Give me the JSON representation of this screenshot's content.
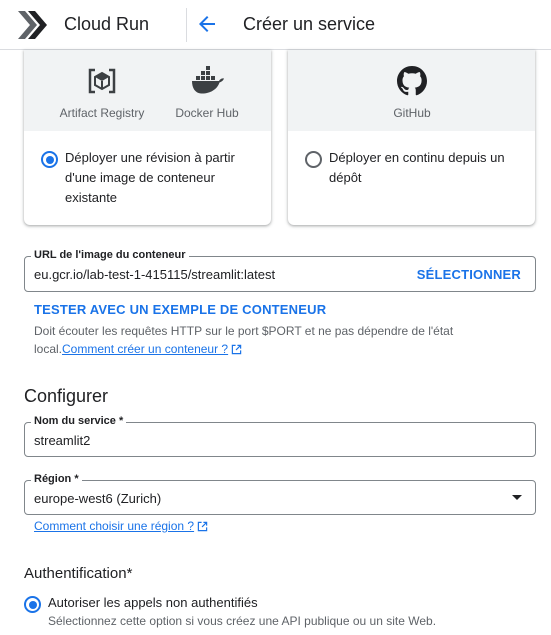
{
  "header": {
    "product": "Cloud Run",
    "page_title": "Créer un service"
  },
  "source_options": {
    "existing": {
      "sources": [
        "Artifact Registry",
        "Docker Hub"
      ],
      "label_lines": [
        "Déployer une révision à partir",
        "d'une image de conteneur",
        "existante"
      ],
      "selected": true
    },
    "continuous": {
      "sources": [
        "GitHub"
      ],
      "label_lines": [
        "Déployer en continu depuis un",
        "dépôt"
      ],
      "selected": false
    }
  },
  "image_url": {
    "label": "URL de l'image du conteneur",
    "value": "eu.gcr.io/lab-test-1-415115/streamlit:latest",
    "select_button": "SÉLECTIONNER"
  },
  "test_sample_link": "TESTER AVEC UN EXEMPLE DE CONTENEUR",
  "container_help": {
    "text_line1": "Doit écouter les requêtes HTTP sur le port $PORT et ne pas dépendre de l'état",
    "text_line2": "local.",
    "link": "Comment créer un conteneur ?"
  },
  "configure": {
    "heading": "Configurer",
    "service_name": {
      "label": "Nom du service *",
      "value": "streamlit2"
    },
    "region": {
      "label": "Région *",
      "value": "europe-west6 (Zurich)"
    },
    "region_help_link": "Comment choisir une région ?"
  },
  "auth": {
    "heading": "Authentification*",
    "option_label": "Autoriser les appels non authentifiés",
    "option_description": "Sélectionnez cette option si vous créez une API publique ou un site Web.",
    "selected": true
  },
  "colors": {
    "accent": "#1a73e8",
    "text": "#202124",
    "muted": "#5f6368",
    "panel": "#f1f3f4"
  }
}
